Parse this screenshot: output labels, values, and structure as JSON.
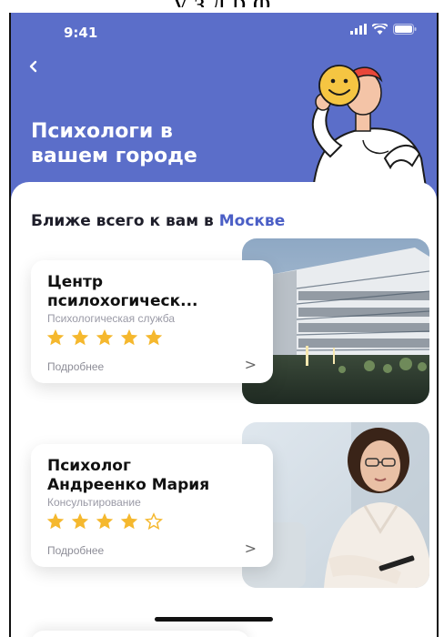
{
  "overflow_text": "у з   д   р ф",
  "status_bar": {
    "time": "9:41"
  },
  "header": {
    "back_icon": "chevron-left-icon",
    "title_line1": "Психологи в",
    "title_line2": "вашем городе",
    "color": "#5b6ec9"
  },
  "nearest": {
    "prefix": "Ближе всего к вам в ",
    "city": "Москве",
    "city_color": "#4b5fc6"
  },
  "cards": [
    {
      "title_line1": "Центр",
      "title_line2": "псилохогическ...",
      "subtitle": "Психологическая служба",
      "rating": 5,
      "more": "Подробнее",
      "arrow": ">",
      "photo": "modern-building-photo"
    },
    {
      "title_line1": "Психолог",
      "title_line2": "Андреенко Мария",
      "subtitle": "Консультирование",
      "rating": 4,
      "more": "Подробнее",
      "arrow": ">",
      "photo": "woman-portrait-photo"
    }
  ],
  "star_color": "#f5b82e"
}
